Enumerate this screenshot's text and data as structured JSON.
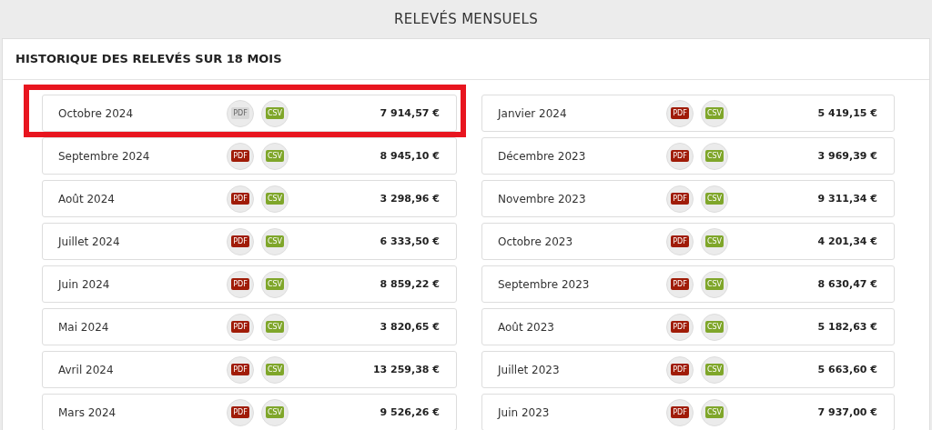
{
  "page_title": "RELEVÉS MENSUELS",
  "panel": {
    "title": "HISTORIQUE DES RELEVÉS SUR 18 MOIS",
    "statements": [
      {
        "month": "Octobre 2024",
        "amount": "7 914,57 €",
        "highlighted": true,
        "pdf": {
          "label": "PDF",
          "disabled": true
        },
        "csv": {
          "label": "CSV",
          "disabled": false
        }
      },
      {
        "month": "Septembre 2024",
        "amount": "8 945,10 €",
        "highlighted": false,
        "pdf": {
          "label": "PDF",
          "disabled": false
        },
        "csv": {
          "label": "CSV",
          "disabled": false
        }
      },
      {
        "month": "Août 2024",
        "amount": "3 298,96 €",
        "highlighted": false,
        "pdf": {
          "label": "PDF",
          "disabled": false
        },
        "csv": {
          "label": "CSV",
          "disabled": false
        }
      },
      {
        "month": "Juillet 2024",
        "amount": "6 333,50 €",
        "highlighted": false,
        "pdf": {
          "label": "PDF",
          "disabled": false
        },
        "csv": {
          "label": "CSV",
          "disabled": false
        }
      },
      {
        "month": "Juin 2024",
        "amount": "8 859,22 €",
        "highlighted": false,
        "pdf": {
          "label": "PDF",
          "disabled": false
        },
        "csv": {
          "label": "CSV",
          "disabled": false
        }
      },
      {
        "month": "Mai 2024",
        "amount": "3 820,65 €",
        "highlighted": false,
        "pdf": {
          "label": "PDF",
          "disabled": false
        },
        "csv": {
          "label": "CSV",
          "disabled": false
        }
      },
      {
        "month": "Avril 2024",
        "amount": "13 259,38 €",
        "highlighted": false,
        "pdf": {
          "label": "PDF",
          "disabled": false
        },
        "csv": {
          "label": "CSV",
          "disabled": false
        }
      },
      {
        "month": "Mars 2024",
        "amount": "9 526,26 €",
        "highlighted": false,
        "pdf": {
          "label": "PDF",
          "disabled": false
        },
        "csv": {
          "label": "CSV",
          "disabled": false
        }
      },
      {
        "month": "Janvier 2024",
        "amount": "5 419,15 €",
        "highlighted": false,
        "pdf": {
          "label": "PDF",
          "disabled": false
        },
        "csv": {
          "label": "CSV",
          "disabled": false
        }
      },
      {
        "month": "Décembre 2023",
        "amount": "3 969,39 €",
        "highlighted": false,
        "pdf": {
          "label": "PDF",
          "disabled": false
        },
        "csv": {
          "label": "CSV",
          "disabled": false
        }
      },
      {
        "month": "Novembre 2023",
        "amount": "9 311,34 €",
        "highlighted": false,
        "pdf": {
          "label": "PDF",
          "disabled": false
        },
        "csv": {
          "label": "CSV",
          "disabled": false
        }
      },
      {
        "month": "Octobre 2023",
        "amount": "4 201,34 €",
        "highlighted": false,
        "pdf": {
          "label": "PDF",
          "disabled": false
        },
        "csv": {
          "label": "CSV",
          "disabled": false
        }
      },
      {
        "month": "Septembre 2023",
        "amount": "8 630,47 €",
        "highlighted": false,
        "pdf": {
          "label": "PDF",
          "disabled": false
        },
        "csv": {
          "label": "CSV",
          "disabled": false
        }
      },
      {
        "month": "Août 2023",
        "amount": "5 182,63 €",
        "highlighted": false,
        "pdf": {
          "label": "PDF",
          "disabled": false
        },
        "csv": {
          "label": "CSV",
          "disabled": false
        }
      },
      {
        "month": "Juillet 2023",
        "amount": "5 663,60 €",
        "highlighted": false,
        "pdf": {
          "label": "PDF",
          "disabled": false
        },
        "csv": {
          "label": "CSV",
          "disabled": false
        }
      },
      {
        "month": "Juin 2023",
        "amount": "7 937,00 €",
        "highlighted": false,
        "pdf": {
          "label": "PDF",
          "disabled": false
        },
        "csv": {
          "label": "CSV",
          "disabled": false
        }
      }
    ]
  }
}
